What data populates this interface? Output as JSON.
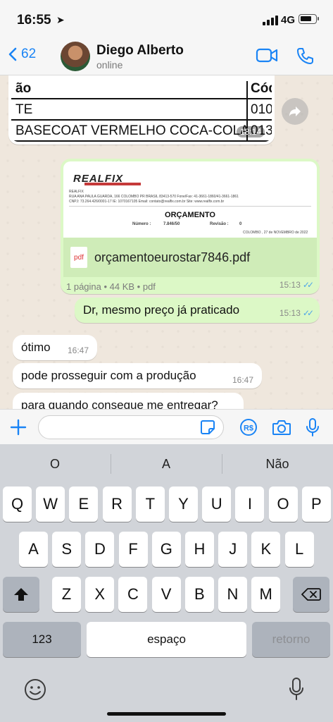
{
  "status_bar": {
    "time": "16:55",
    "network": "4G",
    "battery_level": 0.8
  },
  "header": {
    "back_count": "62",
    "contact_name": "Diego Alberto",
    "contact_status": "online"
  },
  "messages": {
    "image": {
      "rows": [
        {
          "col1": "ão",
          "col2": "Cód"
        },
        {
          "col1": "TE",
          "col2": "010"
        },
        {
          "col1": "BASECOAT VERMELHO COCA-COLA",
          "col2": "013"
        }
      ],
      "time": "18:14"
    },
    "pdf": {
      "logo": "REALFIX",
      "header_line_1": "REALFIX",
      "header_line_2": "RUA ANA PAULA GUARDA, 166        COLOMBO       PR   BRASIL       83413-570      Fone/Fax:   41-3661-1860/41-3661-1861",
      "header_line_3": "CNPJ: 73.264.426/0001-17        IE:  1070167105       Email: contato@realfix.com.br            Site:    www.realfix.com.br",
      "doc_title": "ORÇAMENTO",
      "number_label": "Número :",
      "number_value": "7.846/50",
      "revision_label": "Revisão :",
      "revision_value": "0",
      "date_line": "COLOMBO      , 27 de NOVEMBRO  de 2022",
      "file_icon": "pdf",
      "file_name": "orçamentoeurostar7846.pdf",
      "info": "1 página • 44 KB • pdf",
      "time": "15:13"
    },
    "out_text": {
      "text": "Dr, mesmo preço já praticado",
      "time": "15:13"
    },
    "in_1": {
      "text": "ótimo",
      "time": "16:47"
    },
    "in_2": {
      "text": "pode prosseguir com a produção",
      "time": "16:47"
    },
    "in_3": {
      "text": "para quando consegue me entregar?"
    }
  },
  "keyboard": {
    "suggestions": [
      "O",
      "A",
      "Não"
    ],
    "row1": [
      "Q",
      "W",
      "E",
      "R",
      "T",
      "Y",
      "U",
      "I",
      "O",
      "P"
    ],
    "row2": [
      "A",
      "S",
      "D",
      "F",
      "G",
      "H",
      "J",
      "K",
      "L"
    ],
    "row3": [
      "Z",
      "X",
      "C",
      "V",
      "B",
      "N",
      "M"
    ],
    "numbers_label": "123",
    "space_label": "espaço",
    "return_label": "retorno"
  },
  "colors": {
    "accent": "#1a84f5",
    "outgoing": "#dcf8c6",
    "incoming": "#ffffff",
    "read_ticks": "#4fa6e8"
  },
  "icons": [
    "location-arrow-icon",
    "signal-icon",
    "battery-icon",
    "back-chevron-icon",
    "video-call-icon",
    "phone-icon",
    "forward-icon",
    "plus-icon",
    "sticker-icon",
    "payment-icon",
    "camera-icon",
    "microphone-icon",
    "shift-icon",
    "backspace-icon",
    "emoji-icon",
    "dictation-icon"
  ]
}
